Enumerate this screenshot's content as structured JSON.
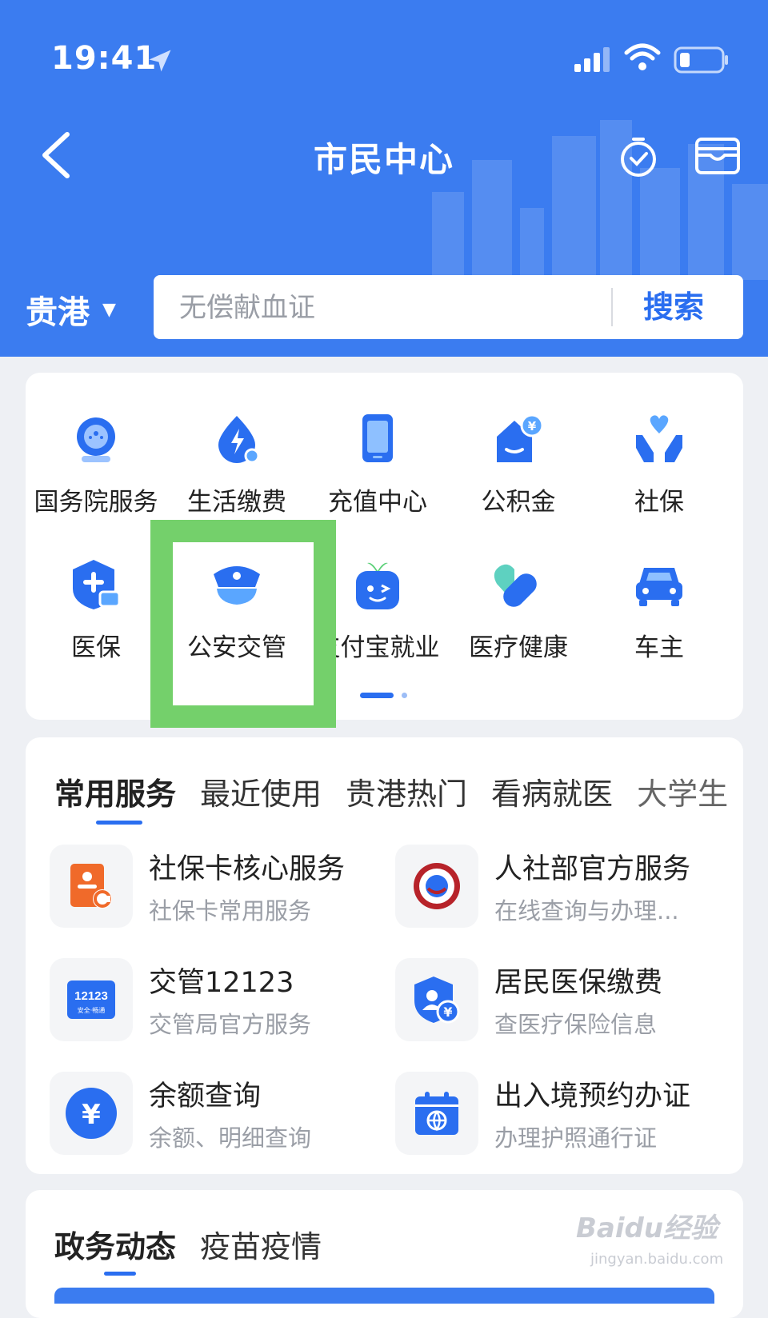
{
  "status_bar": {
    "time": "19:41"
  },
  "header": {
    "title": "市民中心",
    "city": "贵港",
    "search": {
      "placeholder": "无偿献血证",
      "button": "搜索"
    }
  },
  "grid": {
    "items": [
      {
        "label": "国务院服务",
        "icon": "state-council-icon"
      },
      {
        "label": "生活缴费",
        "icon": "utility-payment-icon"
      },
      {
        "label": "充值中心",
        "icon": "phone-recharge-icon"
      },
      {
        "label": "公积金",
        "icon": "housing-fund-icon"
      },
      {
        "label": "社保",
        "icon": "social-security-icon"
      },
      {
        "label": "医保",
        "icon": "medical-insurance-icon"
      },
      {
        "label": "公安交管",
        "icon": "police-cap-icon"
      },
      {
        "label": "支付宝就业",
        "icon": "alipay-job-icon"
      },
      {
        "label": "医疗健康",
        "icon": "health-icon"
      },
      {
        "label": "车主",
        "icon": "car-owner-icon"
      }
    ],
    "page_count": 2,
    "current_page": 1
  },
  "services": {
    "tabs": [
      "常用服务",
      "最近使用",
      "贵港热门",
      "看病就医",
      "大学生"
    ],
    "active_tab": "常用服务",
    "items": [
      {
        "title": "社保卡核心服务",
        "subtitle": "社保卡常用服务",
        "icon": "social-card-icon"
      },
      {
        "title": "人社部官方服务",
        "subtitle": "在线查询与办理...",
        "icon": "mohrss-badge-icon"
      },
      {
        "title": "交管12123",
        "subtitle": "交管局官方服务",
        "icon": "traffic-12123-icon"
      },
      {
        "title": "居民医保缴费",
        "subtitle": "查医疗保险信息",
        "icon": "medical-payment-icon"
      },
      {
        "title": "余额查询",
        "subtitle": "余额、明细查询",
        "icon": "yuan-balance-icon"
      },
      {
        "title": "出入境预约办证",
        "subtitle": "办理护照通行证",
        "icon": "passport-calendar-icon"
      }
    ],
    "icon_12123_text": "12123",
    "icon_12123_sub": "安全·畅通"
  },
  "news": {
    "tabs": [
      "政务动态",
      "疫苗疫情"
    ],
    "active_tab": "政务动态"
  },
  "watermark": {
    "text": "Baidu经验",
    "sub": "jingyan.baidu.com"
  },
  "colors": {
    "primary": "#3b7cf0",
    "accent": "#2a6ef0",
    "highlight": "#74d06b"
  }
}
